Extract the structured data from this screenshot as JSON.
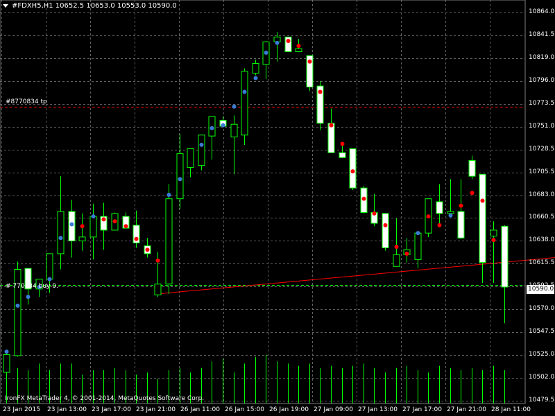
{
  "header": {
    "symbol_line": "#FDXH5,H1  10652.5 10653.0 10553.0 10590.0"
  },
  "order_labels": {
    "tp": "#8770834 tp",
    "open": "# 770834 buy 0."
  },
  "footer": {
    "copyright": "IronFX MetaTrader 4, © 2001-2014, MetaQuotes Software Corp."
  },
  "current_price": "10590.0",
  "colors": {
    "bull": "#00ff00",
    "bear_fill": "#ffffff",
    "grid": "#606060",
    "tp_line": "#ff0000",
    "blue_dot": "#3a7bd5",
    "red_dot": "#ff0000",
    "trend": "#ff0000"
  },
  "chart_data": {
    "type": "candlestick",
    "y_ticks": [
      "10864.0",
      "10841.5",
      "10819.0",
      "10796.0",
      "10773.5",
      "10751.0",
      "10728.5",
      "10705.5",
      "10683.0",
      "10660.5",
      "10638.0",
      "10615.5",
      "10592.5",
      "10570.0",
      "10547.5",
      "10525.0",
      "10502.0",
      "10479.5"
    ],
    "ylim": [
      10474,
      10870
    ],
    "x_labels": [
      "23 Jan 2015",
      "23 Jan 13:00",
      "23 Jan 17:00",
      "23 Jan 21:00",
      "26 Jan 11:00",
      "26 Jan 15:00",
      "26 Jan 19:00",
      "27 Jan 09:00",
      "27 Jan 13:00",
      "27 Jan 17:00",
      "27 Jan 21:00",
      "28 Jan 11:00"
    ],
    "tp_level": 10774,
    "entry_level": 10592,
    "candles": [
      {
        "o": 10503,
        "h": 10523,
        "l": 10490,
        "c": 10521
      },
      {
        "o": 10520,
        "h": 10616,
        "l": 10519,
        "c": 10608
      },
      {
        "o": 10609,
        "h": 10609,
        "l": 10572,
        "c": 10588
      },
      {
        "o": 10588,
        "h": 10597,
        "l": 10580,
        "c": 10598
      },
      {
        "o": 10598,
        "h": 10620,
        "l": 10584,
        "c": 10624
      },
      {
        "o": 10624,
        "h": 10703,
        "l": 10608,
        "c": 10667
      },
      {
        "o": 10667,
        "h": 10679,
        "l": 10620,
        "c": 10637
      },
      {
        "o": 10637,
        "h": 10665,
        "l": 10627,
        "c": 10641
      },
      {
        "o": 10641,
        "h": 10675,
        "l": 10618,
        "c": 10662
      },
      {
        "o": 10662,
        "h": 10676,
        "l": 10628,
        "c": 10648
      },
      {
        "o": 10648,
        "h": 10666,
        "l": 10649,
        "c": 10665
      },
      {
        "o": 10662,
        "h": 10666,
        "l": 10651,
        "c": 10650
      },
      {
        "o": 10653,
        "h": 10668,
        "l": 10630,
        "c": 10635
      },
      {
        "o": 10632,
        "h": 10640,
        "l": 10620,
        "c": 10624
      },
      {
        "o": 10582,
        "h": 10626,
        "l": 10580,
        "c": 10593
      },
      {
        "o": 10593,
        "h": 10695,
        "l": 10583,
        "c": 10680
      },
      {
        "o": 10680,
        "h": 10746,
        "l": 10670,
        "c": 10726
      },
      {
        "o": 10712,
        "h": 10730,
        "l": 10702,
        "c": 10731
      },
      {
        "o": 10714,
        "h": 10745,
        "l": 10709,
        "c": 10745
      },
      {
        "o": 10744,
        "h": 10761,
        "l": 10720,
        "c": 10764
      },
      {
        "o": 10760,
        "h": 10764,
        "l": 10757,
        "c": 10754
      },
      {
        "o": 10743,
        "h": 10765,
        "l": 10705,
        "c": 10756
      },
      {
        "o": 10745,
        "h": 10813,
        "l": 10735,
        "c": 10810
      },
      {
        "o": 10808,
        "h": 10822,
        "l": 10806,
        "c": 10818
      },
      {
        "o": 10817,
        "h": 10841,
        "l": 10802,
        "c": 10840
      },
      {
        "o": 10840,
        "h": 10850,
        "l": 10820,
        "c": 10845
      },
      {
        "o": 10845,
        "h": 10845,
        "l": 10830,
        "c": 10830
      },
      {
        "o": 10830,
        "h": 10843,
        "l": 10830,
        "c": 10833
      },
      {
        "o": 10826,
        "h": 10826,
        "l": 10790,
        "c": 10794
      },
      {
        "o": 10795,
        "h": 10800,
        "l": 10750,
        "c": 10757
      },
      {
        "o": 10757,
        "h": 10772,
        "l": 10738,
        "c": 10727
      },
      {
        "o": 10727,
        "h": 10737,
        "l": 10728,
        "c": 10722
      },
      {
        "o": 10731,
        "h": 10731,
        "l": 10689,
        "c": 10691
      },
      {
        "o": 10691,
        "h": 10693,
        "l": 10665,
        "c": 10666
      },
      {
        "o": 10666,
        "h": 10685,
        "l": 10652,
        "c": 10655
      },
      {
        "o": 10665,
        "h": 10662,
        "l": 10627,
        "c": 10630
      },
      {
        "o": 10611,
        "h": 10660,
        "l": 10613,
        "c": 10623
      },
      {
        "o": 10623,
        "h": 10640,
        "l": 10615,
        "c": 10628
      },
      {
        "o": 10618,
        "h": 10646,
        "l": 10609,
        "c": 10645
      },
      {
        "o": 10645,
        "h": 10678,
        "l": 10641,
        "c": 10680
      },
      {
        "o": 10677,
        "h": 10695,
        "l": 10655,
        "c": 10665
      },
      {
        "o": 10665,
        "h": 10700,
        "l": 10661,
        "c": 10667
      },
      {
        "o": 10667,
        "h": 10700,
        "l": 10639,
        "c": 10640
      },
      {
        "o": 10719,
        "h": 10724,
        "l": 10700,
        "c": 10703
      },
      {
        "o": 10705,
        "h": 10703,
        "l": 10594,
        "c": 10615
      },
      {
        "o": 10642,
        "h": 10657,
        "l": 10594,
        "c": 10648
      },
      {
        "o": 10652,
        "h": 10653,
        "l": 10553,
        "c": 10590
      }
    ],
    "blue_dots": [
      [
        0,
        10524
      ],
      [
        1,
        10571
      ],
      [
        2,
        10580
      ],
      [
        3,
        10590
      ],
      [
        4,
        10598
      ],
      [
        5,
        10640
      ],
      [
        6,
        10654
      ],
      [
        8,
        10662
      ],
      [
        15,
        10684
      ],
      [
        16,
        10700
      ],
      [
        18,
        10735
      ],
      [
        19,
        10752
      ],
      [
        20,
        10755
      ],
      [
        21,
        10774
      ],
      [
        22,
        10789
      ],
      [
        23,
        10803
      ],
      [
        24,
        10829
      ],
      [
        25,
        10839
      ],
      [
        38,
        10645
      ],
      [
        41,
        10663
      ]
    ],
    "red_dots": [
      [
        7,
        10652
      ],
      [
        9,
        10659
      ],
      [
        10,
        10657
      ],
      [
        11,
        10652
      ],
      [
        12,
        10639
      ],
      [
        13,
        10628
      ],
      [
        14,
        10617
      ],
      [
        26,
        10841
      ],
      [
        27,
        10836
      ],
      [
        28,
        10820
      ],
      [
        29,
        10789
      ],
      [
        30,
        10755
      ],
      [
        31,
        10736
      ],
      [
        32,
        10708
      ],
      [
        33,
        10680
      ],
      [
        34,
        10665
      ],
      [
        35,
        10653
      ],
      [
        36,
        10631
      ],
      [
        37,
        10624
      ],
      [
        39,
        10662
      ],
      [
        40,
        10653
      ],
      [
        42,
        10673
      ],
      [
        43,
        10686
      ],
      [
        44,
        10678
      ],
      [
        45,
        10638
      ]
    ],
    "trend_line": [
      [
        14,
        10583
      ],
      [
        49,
        10620
      ]
    ],
    "volume_bars": [
      34,
      32,
      30,
      36,
      30,
      36,
      36,
      26,
      30,
      30,
      32,
      30,
      26,
      28,
      22,
      30,
      32,
      28,
      32,
      38,
      40,
      28,
      36,
      42,
      44,
      38,
      36,
      34,
      36,
      32,
      34,
      32,
      34,
      36,
      32,
      28,
      32,
      34,
      30,
      28,
      34,
      32,
      30,
      32,
      30,
      34,
      30
    ]
  }
}
